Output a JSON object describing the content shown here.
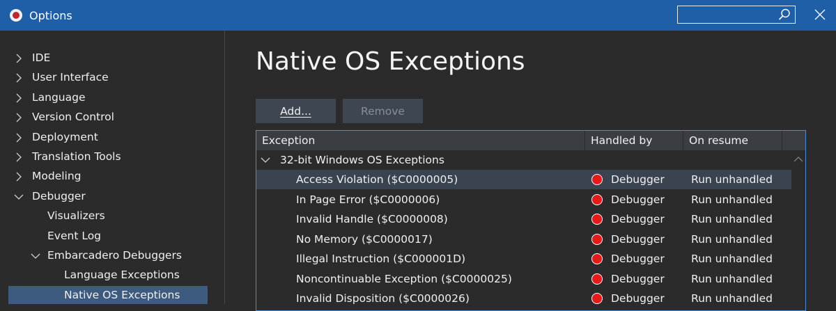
{
  "window": {
    "title": "Options",
    "search_value": "",
    "search_placeholder": ""
  },
  "sidebar": {
    "items": [
      {
        "label": "IDE",
        "level": 0,
        "expandable": true,
        "expanded": false
      },
      {
        "label": "User Interface",
        "level": 0,
        "expandable": true,
        "expanded": false
      },
      {
        "label": "Language",
        "level": 0,
        "expandable": true,
        "expanded": false
      },
      {
        "label": "Version Control",
        "level": 0,
        "expandable": true,
        "expanded": false
      },
      {
        "label": "Deployment",
        "level": 0,
        "expandable": true,
        "expanded": false
      },
      {
        "label": "Translation Tools",
        "level": 0,
        "expandable": true,
        "expanded": false
      },
      {
        "label": "Modeling",
        "level": 0,
        "expandable": true,
        "expanded": false
      },
      {
        "label": "Debugger",
        "level": 0,
        "expandable": true,
        "expanded": true
      },
      {
        "label": "Visualizers",
        "level": 1,
        "expandable": false
      },
      {
        "label": "Event Log",
        "level": 1,
        "expandable": false
      },
      {
        "label": "Embarcadero Debuggers",
        "level": 1,
        "expandable": true,
        "expanded": true
      },
      {
        "label": "Language Exceptions",
        "level": 2,
        "expandable": false
      },
      {
        "label": "Native OS Exceptions",
        "level": 2,
        "expandable": false,
        "selected": true
      }
    ]
  },
  "main": {
    "title": "Native OS Exceptions",
    "add_label": "Add...",
    "remove_label": "Remove",
    "grid": {
      "columns": [
        "Exception",
        "Handled by",
        "On resume"
      ],
      "group": "32-bit Windows OS Exceptions",
      "rows": [
        {
          "exception": "Access Violation ($C0000005)",
          "handled_by": "Debugger",
          "on_resume": "Run unhandled",
          "selected": true
        },
        {
          "exception": "In Page Error ($C0000006)",
          "handled_by": "Debugger",
          "on_resume": "Run unhandled"
        },
        {
          "exception": "Invalid Handle ($C0000008)",
          "handled_by": "Debugger",
          "on_resume": "Run unhandled"
        },
        {
          "exception": "No Memory ($C0000017)",
          "handled_by": "Debugger",
          "on_resume": "Run unhandled"
        },
        {
          "exception": "Illegal Instruction ($C000001D)",
          "handled_by": "Debugger",
          "on_resume": "Run unhandled"
        },
        {
          "exception": "Noncontinuable Exception ($C0000025)",
          "handled_by": "Debugger",
          "on_resume": "Run unhandled"
        },
        {
          "exception": "Invalid Disposition ($C0000026)",
          "handled_by": "Debugger",
          "on_resume": "Run unhandled"
        }
      ]
    }
  },
  "colors": {
    "titlebar": "#1e5fa8",
    "background": "#2b2b2b",
    "selection": "#3d5a7f",
    "debugger_dot": "#e81919"
  }
}
